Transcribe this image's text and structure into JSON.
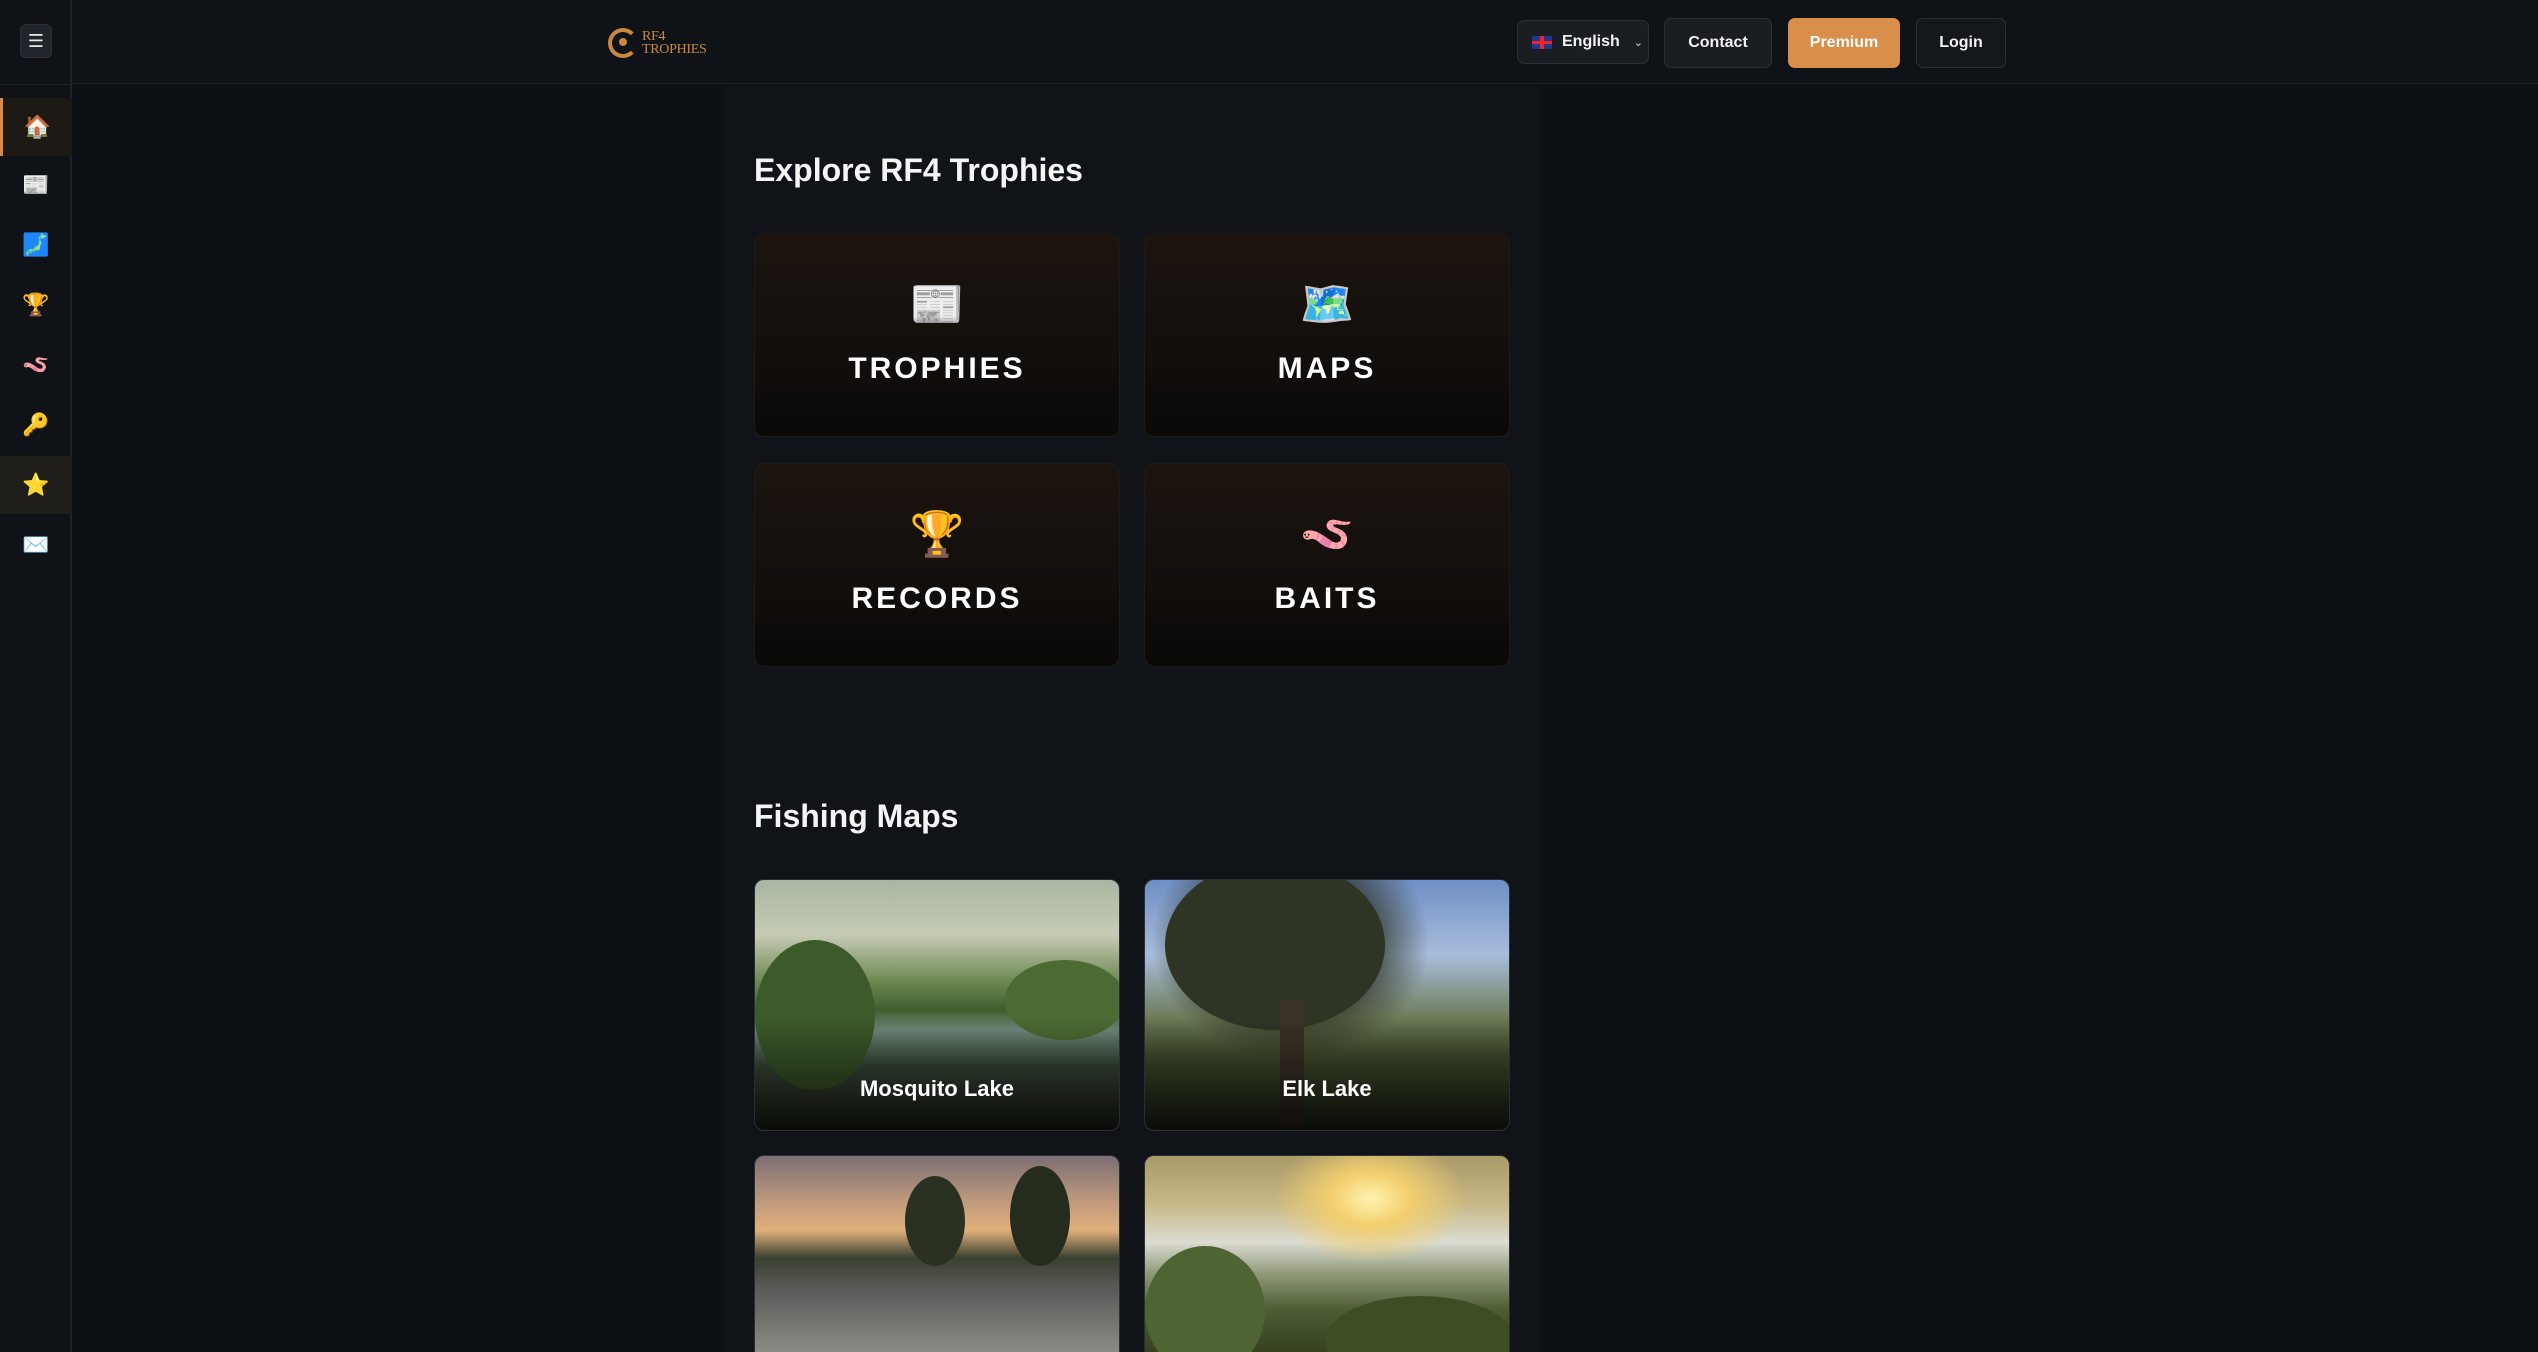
{
  "sidebar": {
    "menu_icon": "☰",
    "items": [
      {
        "icon": "home-icon",
        "glyph": "🏠"
      },
      {
        "icon": "newspaper-icon",
        "glyph": "📰"
      },
      {
        "icon": "map-icon",
        "glyph": "🗾"
      },
      {
        "icon": "trophy-icon",
        "glyph": "🏆"
      },
      {
        "icon": "worm-icon",
        "glyph": "🪱"
      },
      {
        "icon": "key-icon",
        "glyph": "🔑"
      },
      {
        "icon": "star-icon",
        "glyph": "⭐"
      },
      {
        "icon": "mail-icon",
        "glyph": "✉️"
      }
    ]
  },
  "header": {
    "logo_line1": "RF4",
    "logo_line2": "TROPHIES",
    "language": "English",
    "contact_label": "Contact",
    "premium_label": "Premium",
    "login_label": "Login"
  },
  "explore": {
    "title": "Explore RF4 Trophies",
    "cards": [
      {
        "label": "TROPHIES",
        "glyph": "📰"
      },
      {
        "label": "MAPS",
        "glyph": "🗺️"
      },
      {
        "label": "RECORDS",
        "glyph": "🏆"
      },
      {
        "label": "BAITS",
        "glyph": "🪱"
      }
    ]
  },
  "maps": {
    "title": "Fishing Maps",
    "items": [
      {
        "name": "Mosquito Lake"
      },
      {
        "name": "Elk Lake"
      },
      {
        "name": ""
      },
      {
        "name": ""
      }
    ]
  },
  "colors": {
    "accent": "#d98e4a",
    "background": "#0d1014"
  }
}
